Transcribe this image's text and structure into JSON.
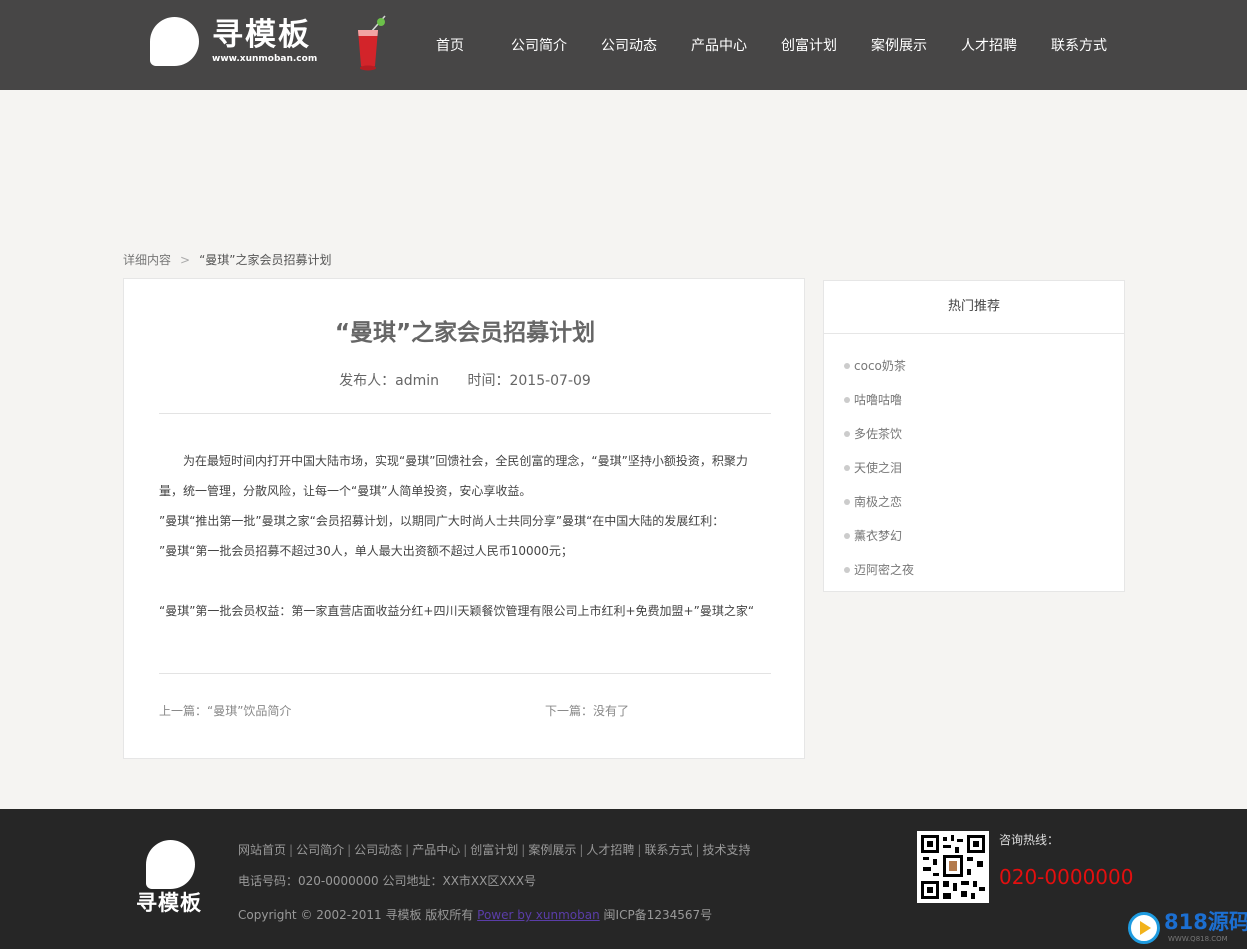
{
  "header": {
    "logo_text": "寻模板",
    "logo_url": "www.xunmoban.com",
    "nav": [
      "首页",
      "公司简介",
      "公司动态",
      "产品中心",
      "创富计划",
      "案例展示",
      "人才招聘",
      "联系方式"
    ]
  },
  "breadcrumb": {
    "parent": "详细内容",
    "separator": ">",
    "current": "“曼琪”之家会员招募计划"
  },
  "article": {
    "title": "“曼琪”之家会员招募计划",
    "author_label": "发布人：admin",
    "time_label": "时间：2015-07-09",
    "paragraphs": [
      "　　为在最短时间内打开中国大陆市场，实现“曼琪”回馈社会，全民创富的理念，“曼琪”坚持小额投资，积聚力量，统一管理，分散风险，让每一个“曼琪”人简单投资，安心享收益。",
      "”曼琪“推出第一批”曼琪之家“会员招募计划，以期同广大时尚人士共同分享”曼琪“在中国大陆的发展红利：",
      "”曼琪“第一批会员招募不超过30人，单人最大出资额不超过人民币10000元；",
      "“曼琪”第一批会员权益：第一家直营店面收益分红+四川天颖餐饮管理有限公司上市红利+免费加盟+”曼琪之家“"
    ],
    "prev": "上一篇：“曼琪”饮品简介",
    "next": "下一篇：没有了"
  },
  "sidebar": {
    "title": "热门推荐",
    "items": [
      "coco奶茶",
      "咕噜咕噜",
      "多佐茶饮",
      "天使之泪",
      "南极之恋",
      "薰衣梦幻",
      "迈阿密之夜"
    ]
  },
  "footer": {
    "logo_text": "寻模板",
    "links": [
      "网站首页",
      "公司简介",
      "公司动态",
      "产品中心",
      "创富计划",
      "案例展示",
      "人才招聘",
      "联系方式",
      "技术支持"
    ],
    "contact": "电话号码：020-0000000 公司地址：XX市XX区XXX号",
    "copyright": "Copyright © 2002-2011 寻模板 版权所有",
    "power_link": "Power by xunmoban",
    "icp": "闽ICP备1234567号",
    "hotline_label": "咨询热线：",
    "hotline": "020-0000000"
  },
  "watermark": {
    "text": "818源码",
    "sub": "WWW.Q818.COM"
  },
  "colors": {
    "header_bg": "#474646",
    "footer_bg": "#262626",
    "hotline": "#e30f0f"
  }
}
